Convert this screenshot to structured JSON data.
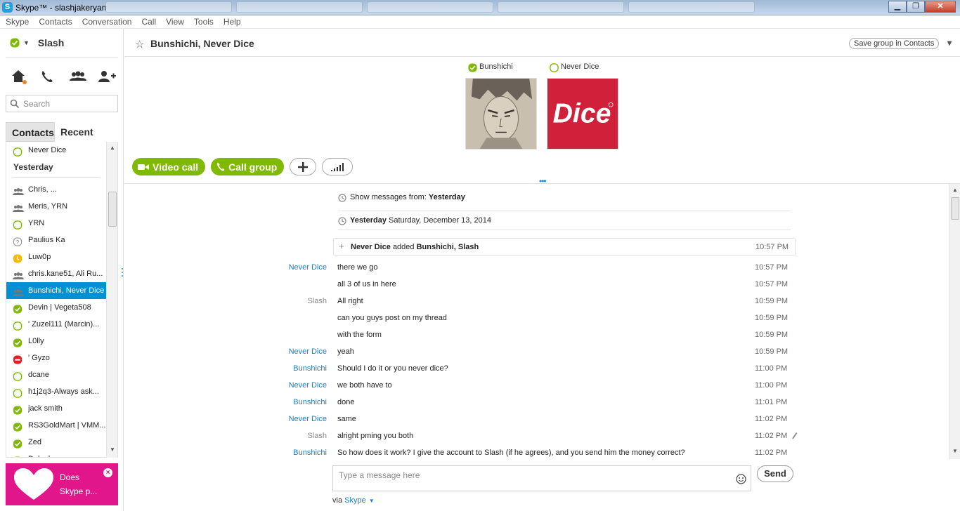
{
  "window": {
    "title": "Skype™ - slashjakeryan",
    "logo_letter": "S",
    "minimize": "▁",
    "maximize": "❐",
    "close": "✕"
  },
  "menu": [
    "Skype",
    "Contacts",
    "Conversation",
    "Call",
    "View",
    "Tools",
    "Help"
  ],
  "user": {
    "name": "Slash",
    "status_color": "#7fba00"
  },
  "search": {
    "placeholder": "Search"
  },
  "tabs": {
    "contacts": "Contacts",
    "recent": "Recent"
  },
  "contacts": {
    "top": {
      "label": "Never Dice",
      "status": "offline"
    },
    "section_header": "Yesterday",
    "items": [
      {
        "label": "Chris, ...",
        "status": "group"
      },
      {
        "label": "Meris, YRN",
        "status": "group"
      },
      {
        "label": "YRN",
        "status": "offline"
      },
      {
        "label": "Paulius Ka",
        "status": "unknown"
      },
      {
        "label": "Luw0p",
        "status": "away"
      },
      {
        "label": "chris.kane51, Ali Ru...",
        "status": "group"
      },
      {
        "label": "Bunshichi, Never Dice",
        "status": "group",
        "selected": true
      },
      {
        "label": "Devin | Vegeta508",
        "status": "online"
      },
      {
        "label": "' Zuzel111 (Marcin)...",
        "status": "offline"
      },
      {
        "label": "L0lly",
        "status": "online"
      },
      {
        "label": "'    Gyzo",
        "status": "dnd"
      },
      {
        "label": "dcane",
        "status": "offline"
      },
      {
        "label": "h1j2q3-Always ask...",
        "status": "offline"
      },
      {
        "label": "jack smith",
        "status": "online"
      },
      {
        "label": "RS3GoldMart | VMM...",
        "status": "online"
      },
      {
        "label": "Zed",
        "status": "online"
      },
      {
        "label": "Dolpek...",
        "status": "online"
      }
    ]
  },
  "promo": {
    "line1": "Does",
    "line2": "Skype p...",
    "close": "×",
    "color": "#e2168b"
  },
  "conversation": {
    "title": "Bunshichi, Never Dice",
    "save_group": "Save group in Contacts",
    "more": "▾",
    "participants": [
      {
        "name": "Bunshichi",
        "status": "online"
      },
      {
        "name": "Never Dice",
        "status": "offline",
        "logo_text": "Dice",
        "logo_color": "#d0213a"
      }
    ],
    "video_call": "Video call",
    "call_group": "Call group",
    "show_from_label": "Show messages from:",
    "show_from_value": "Yesterday",
    "date_bold": "Yesterday",
    "date_rest": "Saturday, December 13, 2014",
    "added": {
      "actor": "Never Dice",
      "verb": "added",
      "targets": "Bunshichi, Slash",
      "time": "10:57 PM"
    },
    "messages": [
      {
        "sender": "Never Dice",
        "color": "blue",
        "text": "there we go",
        "time": "10:57 PM"
      },
      {
        "sender": "",
        "color": "blue",
        "text": "all 3 of us in here",
        "time": "10:57 PM"
      },
      {
        "sender": "Slash",
        "color": "gray",
        "text": "All right",
        "time": "10:59 PM"
      },
      {
        "sender": "",
        "color": "gray",
        "text": "can you guys post on my thread",
        "time": "10:59 PM"
      },
      {
        "sender": "",
        "color": "gray",
        "text": "with the form",
        "time": "10:59 PM"
      },
      {
        "sender": "Never Dice",
        "color": "blue",
        "text": "yeah",
        "time": "10:59 PM"
      },
      {
        "sender": "Bunshichi",
        "color": "blue",
        "text": "Should I do it or you never dice?",
        "time": "11:00 PM"
      },
      {
        "sender": "Never Dice",
        "color": "blue",
        "text": "we both have to",
        "time": "11:00 PM"
      },
      {
        "sender": "Bunshichi",
        "color": "blue",
        "text": "done",
        "time": "11:01 PM"
      },
      {
        "sender": "Never Dice",
        "color": "blue",
        "text": "same",
        "time": "11:02 PM"
      },
      {
        "sender": "Slash",
        "color": "gray",
        "text": "alright pming you both",
        "time": "11:02 PM"
      },
      {
        "sender": "Bunshichi",
        "color": "blue",
        "text": "So how does it work? I give the account to Slash (if he agrees), and you send him the money correct?",
        "time": "11:02 PM"
      }
    ],
    "compose_placeholder": "Type a message here",
    "send": "Send",
    "via_label": "via",
    "via_link": "Skype"
  },
  "colors": {
    "accent": "#0091d5",
    "green": "#7fba00",
    "link": "#1a7fc9"
  }
}
